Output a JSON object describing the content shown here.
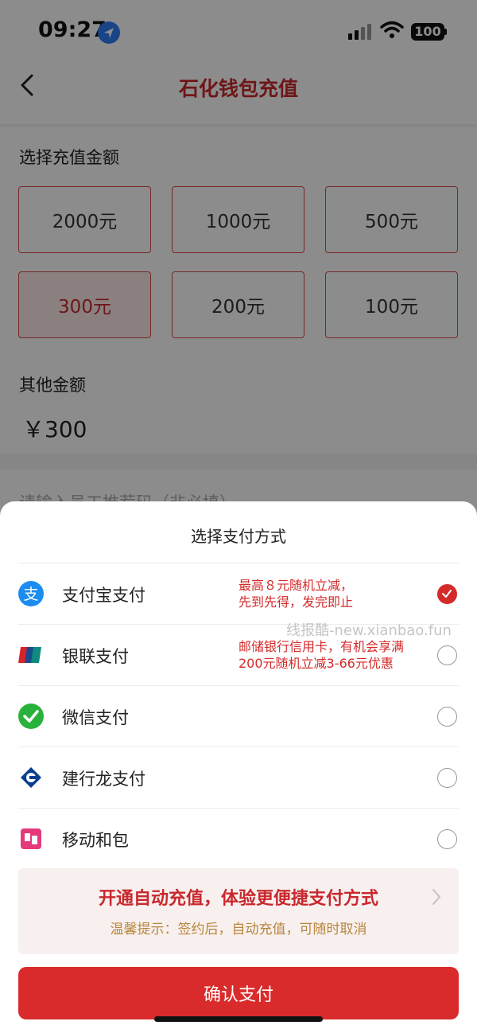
{
  "status": {
    "time": "09:27",
    "battery": "100"
  },
  "nav": {
    "title": "石化钱包充值"
  },
  "recharge": {
    "label": "选择充值金额",
    "amounts": [
      "2000元",
      "1000元",
      "500元",
      "300元",
      "200元",
      "100元"
    ],
    "selected": "300元",
    "other_label": "其他金额",
    "other_value": "￥300",
    "referral_placeholder": "请输入员工推荐码（非必填）"
  },
  "sheet": {
    "title": "选择支付方式",
    "methods": [
      {
        "label": "支付宝支付",
        "promo": "最高８元随机立减，\n先到先得，发完即止",
        "icon": "alipay-icon",
        "selected": true
      },
      {
        "label": "银联支付",
        "promo": "邮储银行信用卡，有机会享满\n200元随机立减3-66元优惠",
        "icon": "unionpay-icon",
        "selected": false
      },
      {
        "label": "微信支付",
        "promo": "",
        "icon": "wechat-pay-icon",
        "selected": false
      },
      {
        "label": "建行龙支付",
        "promo": "",
        "icon": "ccb-icon",
        "selected": false
      },
      {
        "label": "移动和包",
        "promo": "",
        "icon": "hebao-icon",
        "selected": false
      }
    ],
    "watermark": "线报酷-new.xianbao.fun",
    "auto_recharge": {
      "title": "开通自动充值，体验更便捷支付方式",
      "tip": "温馨提示：签约后，自动充值，可随时取消"
    },
    "confirm_label": "确认支付"
  },
  "colors": {
    "accent": "#d92b2b",
    "brand_red": "#c8282d",
    "tip_gold": "#b8863c"
  }
}
